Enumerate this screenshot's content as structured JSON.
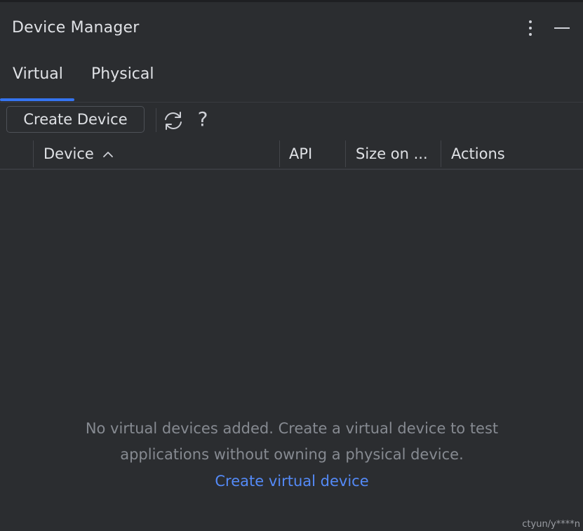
{
  "panel": {
    "title": "Device Manager"
  },
  "tabs": [
    {
      "label": "Virtual",
      "selected": true
    },
    {
      "label": "Physical",
      "selected": false
    }
  ],
  "toolbar": {
    "create_label": "Create Device",
    "help_label": "?"
  },
  "table": {
    "columns": [
      "Device",
      "API",
      "Size on ...",
      "Actions"
    ],
    "sort_column": "Device",
    "sort_direction": "ascending"
  },
  "empty_state": {
    "line1": "No virtual devices added. Create a virtual device to test",
    "line2": "applications without owning a physical device.",
    "link": "Create virtual device"
  },
  "watermark": "ctyun/y****n",
  "colors": {
    "background": "#2b2d30",
    "accent": "#3574f0",
    "link": "#548af7",
    "muted_text": "#868a91"
  }
}
